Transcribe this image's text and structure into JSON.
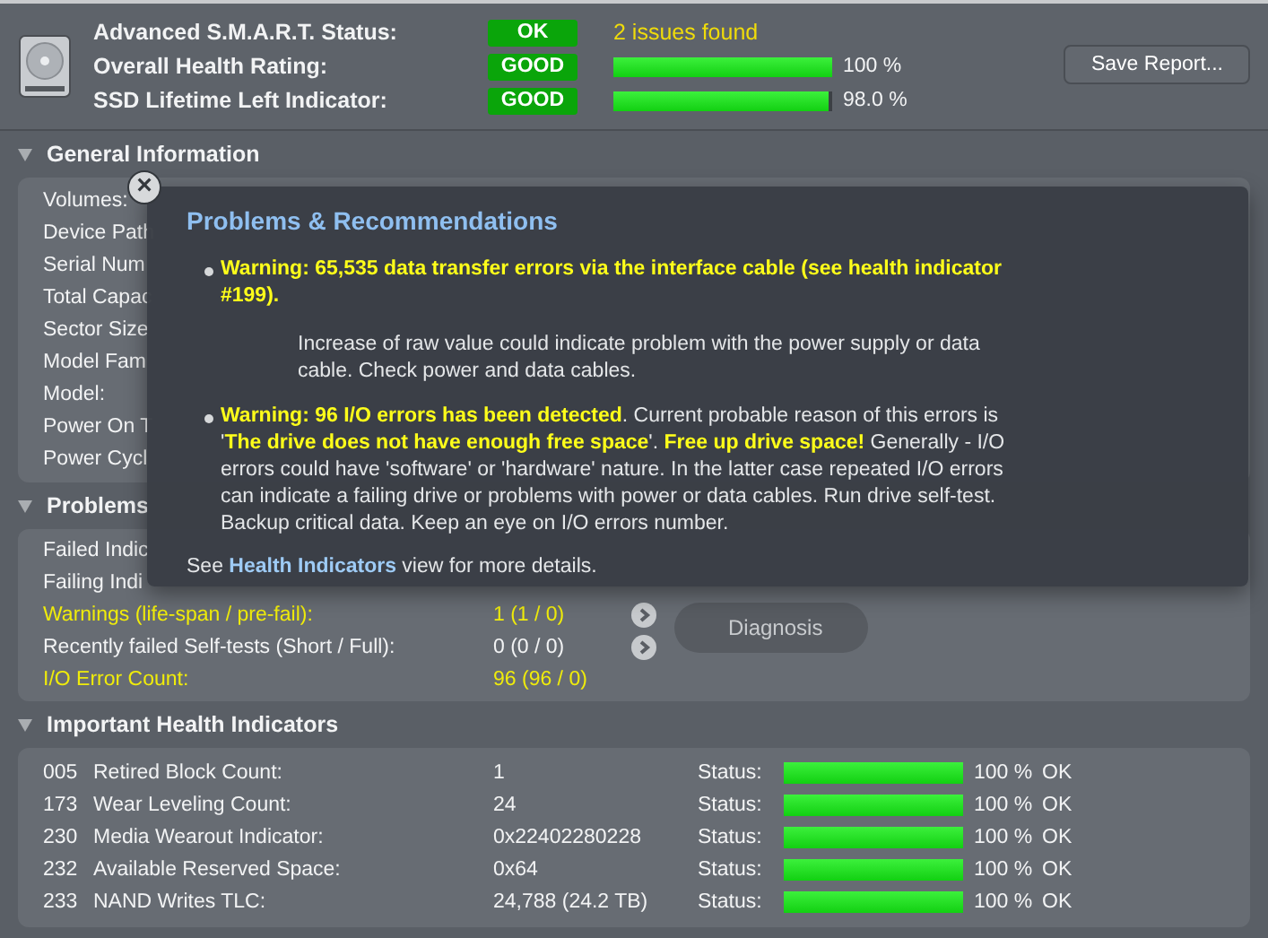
{
  "summary": {
    "rows": [
      {
        "label": "Advanced S.M.A.R.T. Status:",
        "badge": "OK",
        "kind": "note",
        "note": "2 issues found"
      },
      {
        "label": "Overall Health Rating:",
        "badge": "GOOD",
        "kind": "bar",
        "level": 1,
        "reading": "100 %"
      },
      {
        "label": "SSD Lifetime Left Indicator:",
        "badge": "GOOD",
        "kind": "bar",
        "level": 0.98,
        "reading": "98.0 %"
      }
    ],
    "save_button": "Save Report..."
  },
  "general": {
    "title": "General Information",
    "expanded": true,
    "rows": [
      "Volumes:",
      "Device Path",
      "Serial Num",
      "Total Capac",
      "Sector Size",
      "Model Fam",
      "Model:",
      "Power On T",
      "Power Cycl"
    ]
  },
  "problems": {
    "title": "Problems",
    "expanded": true,
    "rows": [
      {
        "label": "Failed Indic",
        "warning": false,
        "arrow": false
      },
      {
        "label": "Failing Indi",
        "warning": false,
        "arrow": false
      },
      {
        "label": "Warnings (life-span / pre-fail):",
        "value": "1  (1 / 0)",
        "warning": true,
        "arrow": true
      },
      {
        "label": "Recently failed Self-tests (Short / Full):",
        "value": "0  (0 / 0)",
        "warning": false,
        "arrow": true
      },
      {
        "label": "I/O Error Count:",
        "value": "96  (96 / 0)",
        "warning": true,
        "arrow": false
      }
    ],
    "diagnosis_button": "Diagnosis"
  },
  "health": {
    "title": "Important Health Indicators",
    "expanded": true,
    "rows": [
      {
        "id": "005",
        "name": "Retired Block Count:",
        "value": "1",
        "status_label": "Status:",
        "level": 1,
        "reading": "100 %",
        "status": "OK"
      },
      {
        "id": "173",
        "name": "Wear Leveling Count:",
        "value": "24",
        "status_label": "Status:",
        "level": 1,
        "reading": "100 %",
        "status": "OK"
      },
      {
        "id": "230",
        "name": "Media Wearout Indicator:",
        "value": "0x22402280228",
        "status_label": "Status:",
        "level": 1,
        "reading": "100 %",
        "status": "OK"
      },
      {
        "id": "232",
        "name": "Available Reserved Space:",
        "value": "0x64",
        "status_label": "Status:",
        "level": 1,
        "reading": "100 %",
        "status": "OK"
      },
      {
        "id": "233",
        "name": "NAND Writes TLC:",
        "value": "24,788 (24.2 TB)",
        "status_label": "Status:",
        "level": 1,
        "reading": "100 %",
        "status": "OK"
      }
    ]
  },
  "popup": {
    "close": "×",
    "title": "Problems & Recommendations",
    "items": [
      {
        "text": "**Warning: 65,535 data transfer errors via the interface cable (see health indicator #199).**",
        "detail": "Increase of raw value could indicate problem with the power supply or data cable. Check power and data cables."
      },
      {
        "text": "**Warning: 96 I/O errors has been detected**. Current probable reason of this errors is '**The drive does not have enough free space**'. **Free up drive space!** Generally - I/O errors could have 'software' or 'hardware' nature. In the latter case repeated I/O errors can indicate a failing drive or problems with power or data cables. Run drive self-test. Backup critical data. Keep an eye on I/O errors number."
      }
    ],
    "footer": {
      "before": "See",
      "link": "Health Indicators",
      "after": "view for more details."
    }
  }
}
